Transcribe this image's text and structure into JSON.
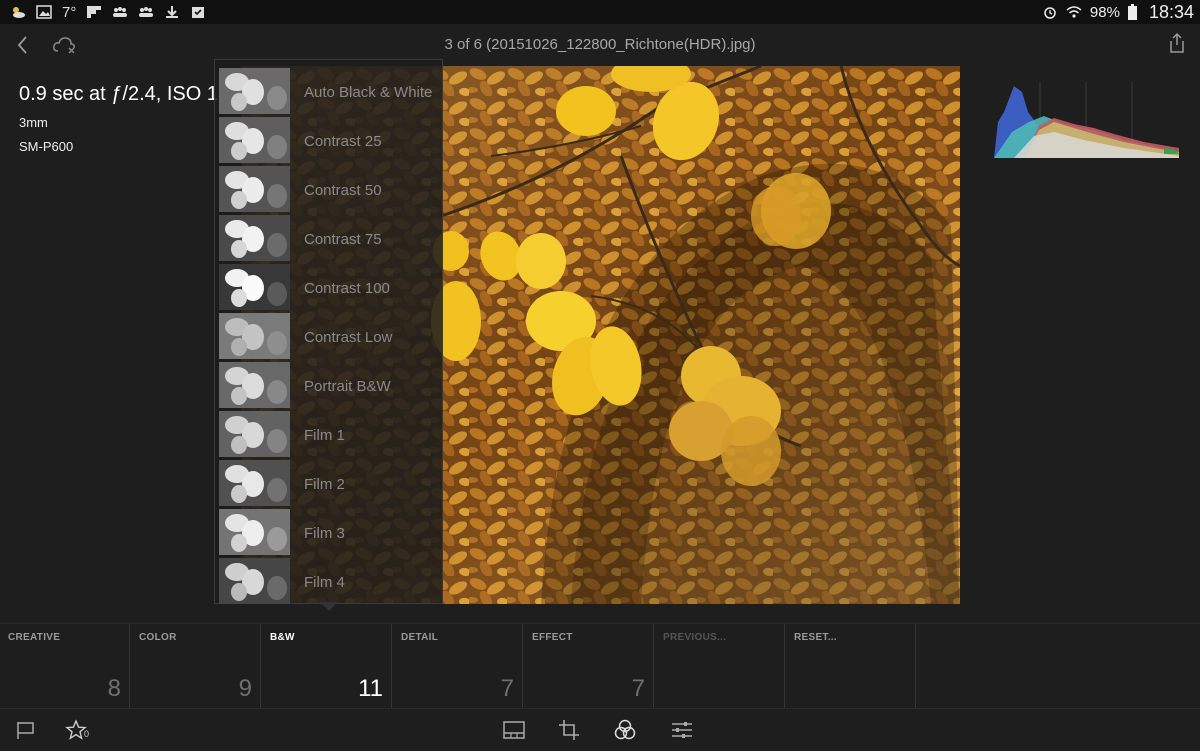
{
  "status": {
    "temperature": "7°",
    "battery": "98%",
    "time": "18:34"
  },
  "topbar": {
    "title": "3 of 6 (20151026_122800_Richtone(HDR).jpg)"
  },
  "metadata": {
    "exposure": "0.9 sec at ƒ/2.4, ISO 1",
    "focal": "3mm",
    "camera": "SM-P600"
  },
  "presets": [
    {
      "label": "Auto Black & White"
    },
    {
      "label": "Contrast 25"
    },
    {
      "label": "Contrast 50"
    },
    {
      "label": "Contrast 75"
    },
    {
      "label": "Contrast 100"
    },
    {
      "label": "Contrast Low"
    },
    {
      "label": "Portrait B&W"
    },
    {
      "label": "Film 1"
    },
    {
      "label": "Film 2"
    },
    {
      "label": "Film 3"
    },
    {
      "label": "Film 4"
    }
  ],
  "tabs": [
    {
      "label": "CREATIVE",
      "count": "8"
    },
    {
      "label": "COLOR",
      "count": "9"
    },
    {
      "label": "B&W",
      "count": "11"
    },
    {
      "label": "DETAIL",
      "count": "7"
    },
    {
      "label": "EFFECT",
      "count": "7"
    },
    {
      "label": "PREVIOUS...",
      "count": ""
    },
    {
      "label": "RESET...",
      "count": ""
    }
  ],
  "bottom": {
    "stars_count": "0"
  },
  "colors": {
    "background": "#1e1e1e",
    "panel": "#1c1c1c",
    "leaf_yellow": "#e8b81c",
    "leaf_brown": "#8a4c16"
  }
}
